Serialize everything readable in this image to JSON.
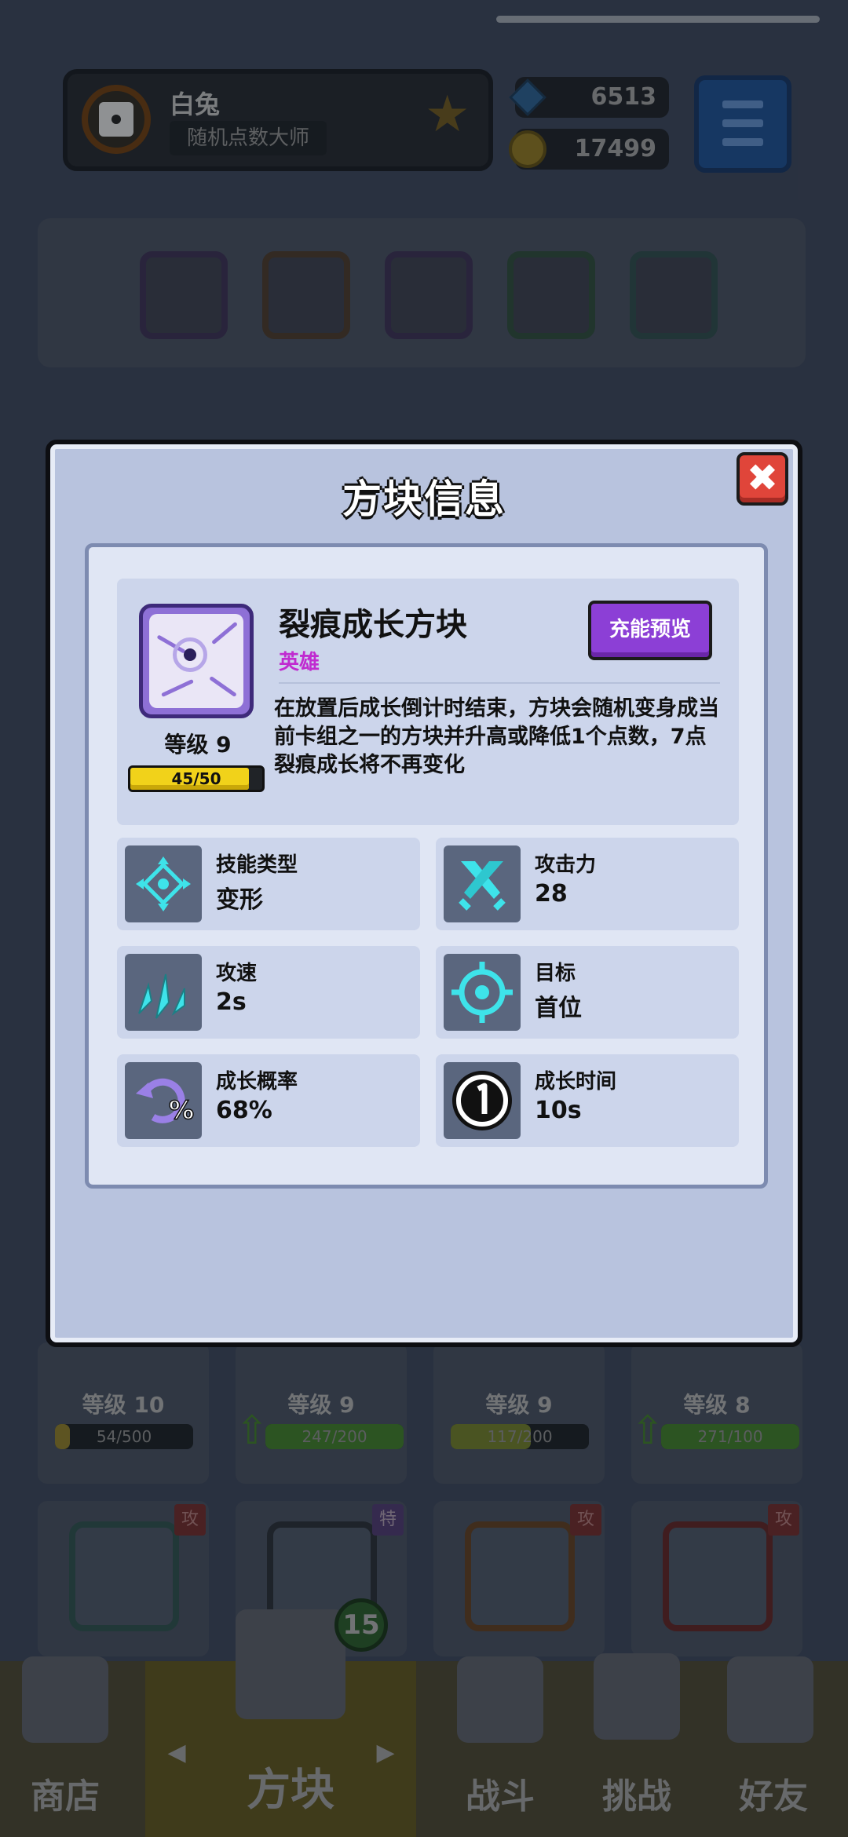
{
  "player": {
    "name": "白兔",
    "title": "随机点数大师",
    "rank_badge": "0"
  },
  "currency": {
    "gems": "6513",
    "coins": "17499"
  },
  "grid_cards": [
    {
      "level": "等级 10",
      "progress": "54/500",
      "progress_fraction": 0.11,
      "bar_color": "#8a7a2a",
      "can_upgrade": false
    },
    {
      "level": "等级 9",
      "progress": "247/200",
      "progress_fraction": 1.0,
      "bar_color": "#3f7a2a",
      "can_upgrade": true
    },
    {
      "level": "等级 9",
      "progress": "117/200",
      "progress_fraction": 0.58,
      "bar_color": "#6e7a2a",
      "can_upgrade": false
    },
    {
      "level": "等级 8",
      "progress": "271/100",
      "progress_fraction": 1.0,
      "bar_color": "#3f7a2a",
      "can_upgrade": true
    }
  ],
  "lower_tags": [
    "攻",
    "特",
    "攻",
    "攻"
  ],
  "deck_count": "15",
  "nav": {
    "shop": "商店",
    "blocks": "方块",
    "battle": "战斗",
    "challenge": "挑战",
    "friends": "好友",
    "left_arrow": "◀",
    "right_arrow": "▶"
  },
  "modal": {
    "title": "方块信息",
    "close": "✖",
    "block": {
      "name": "裂痕成长方块",
      "rarity": "英雄",
      "rarity_color": "#c02bd0",
      "level": "等级 9",
      "xp": "45/50",
      "xp_fraction": 0.9,
      "preview_button": "充能预览",
      "description": "在放置后成长倒计时结束，方块会随机变身成当前卡组之一的方块并升高或降低1个点数，7点裂痕成长将不再变化"
    },
    "stats": [
      {
        "label": "技能类型",
        "value": "变形",
        "icon": "transform-icon"
      },
      {
        "label": "攻击力",
        "value": "28",
        "icon": "crossed-swords-icon"
      },
      {
        "label": "攻速",
        "value": "2s",
        "icon": "attack-speed-icon"
      },
      {
        "label": "目标",
        "value": "首位",
        "icon": "target-icon"
      },
      {
        "label": "成长概率",
        "value": "68%",
        "icon": "growth-chance-icon"
      },
      {
        "label": "成长时间",
        "value": "10s",
        "icon": "clock-icon"
      }
    ]
  }
}
